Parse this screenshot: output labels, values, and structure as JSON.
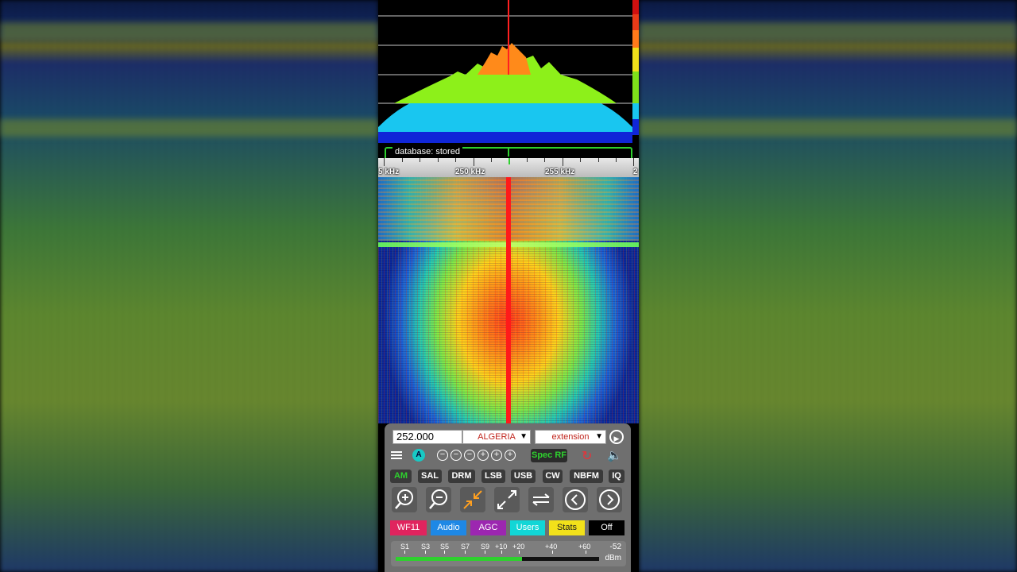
{
  "spectrum": {
    "database_label": "database: stored",
    "scale_labels": [
      "5 kHz",
      "250 kHz",
      "255 kHz",
      "2"
    ]
  },
  "controls": {
    "frequency_value": "252.000",
    "band_select": "ALGERIA",
    "extension_select": "extension",
    "spec_rf_label": "Spec RF",
    "auto_label": "A",
    "modes": [
      "AM",
      "SAL",
      "DRM",
      "LSB",
      "USB",
      "CW",
      "NBFM",
      "IQ"
    ],
    "active_mode": "AM",
    "buttons": [
      {
        "label": "WF11",
        "color": "#e0245e",
        "text_color": "#ffffff"
      },
      {
        "label": "Audio",
        "color": "#1e88e5",
        "text_color": "#ffffff"
      },
      {
        "label": "AGC",
        "color": "#9c27b0",
        "text_color": "#ffffff"
      },
      {
        "label": "Users",
        "color": "#12d6d6",
        "text_color": "#ffffff"
      },
      {
        "label": "Stats",
        "color": "#f2e11a",
        "text_color": "#222222"
      },
      {
        "label": "Off",
        "color": "#000000",
        "text_color": "#ffffff"
      }
    ]
  },
  "smeter": {
    "labels": [
      "S1",
      "S3",
      "S5",
      "S7",
      "S9",
      "+10",
      "+20",
      "+40",
      "+60"
    ],
    "value": "-52",
    "unit": "dBm",
    "level_fraction": 0.62
  },
  "colors": {
    "accent_green": "#2ed12e",
    "panel_bg": "#6f6f6f",
    "signal_red": "#ff1a1a"
  }
}
